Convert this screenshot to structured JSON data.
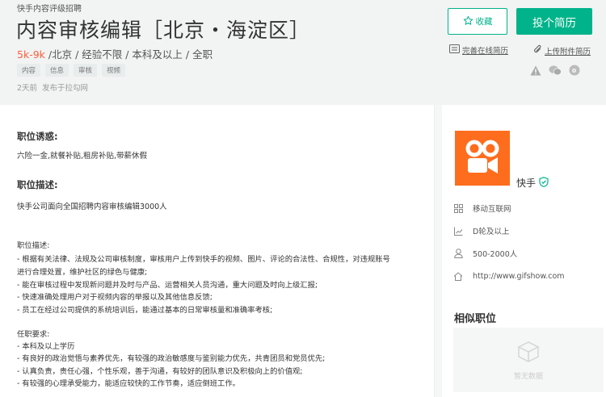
{
  "header": {
    "company_line": "快手内容评级招聘",
    "title": "内容审核编辑［北京・海淀区］",
    "salary": "5k-9k",
    "meta_rest": " /北京 / 经验不限 / 本科及以上 / 全职",
    "tags": [
      "内容",
      "信息",
      "审核",
      "视频"
    ],
    "publish_time": "2天前",
    "publish_source": "发布于拉勾网"
  },
  "actions": {
    "favorite": "收藏",
    "apply": "投个简历",
    "online_resume": "完善在线简历",
    "upload_resume": "上传附件简历"
  },
  "content": {
    "advantage_title": "职位诱惑:",
    "advantage_text": "六险一金,就餐补贴,租房补贴,带薪休假",
    "desc_title": "职位描述:",
    "desc_intro": "快手公司面向全国招聘内容审核编辑3000人",
    "desc_lines": [
      "职位描述:",
      "- 根据有关法律、法规及公司审核制度，审核用户上传到快手的视频、图片、评论的合法性、合规性，对违规账号",
      "进行合理处置，维护社区的绿色与健康;",
      "- 能在审核过程中发现新问题并及时与产品、运营相关人员沟通，重大问题及时向上级汇报;",
      "- 快速准确处理用户对于视频内容的举报以及其他信息反馈;",
      "- 员工在经过公司提供的系统培训后，能通过基本的日常审核量和准确率考核;",
      "",
      "任职要求:",
      "- 本科及以上学历",
      "- 有良好的政治觉悟与素养优先，有较强的政治敏感度与鉴别能力优先，共青团员和党员优先;",
      "- 认真负责，责任心强，个性乐观，善于沟通，有较好的团队意识及积极向上的价值观;",
      "- 有较强的心理承受能力，能适应较快的工作节奏，适应倒班工作。"
    ]
  },
  "company": {
    "name": "快手",
    "industry": "移动互联网",
    "stage": "D轮及以上",
    "size": "500-2000人",
    "website": "http://www.gifshow.com"
  },
  "similar": {
    "title": "相似职位",
    "empty": "暂无数据"
  },
  "colors": {
    "accent": "#00b38a",
    "salary": "#fd5f39",
    "logo": "#fe6d1e"
  }
}
